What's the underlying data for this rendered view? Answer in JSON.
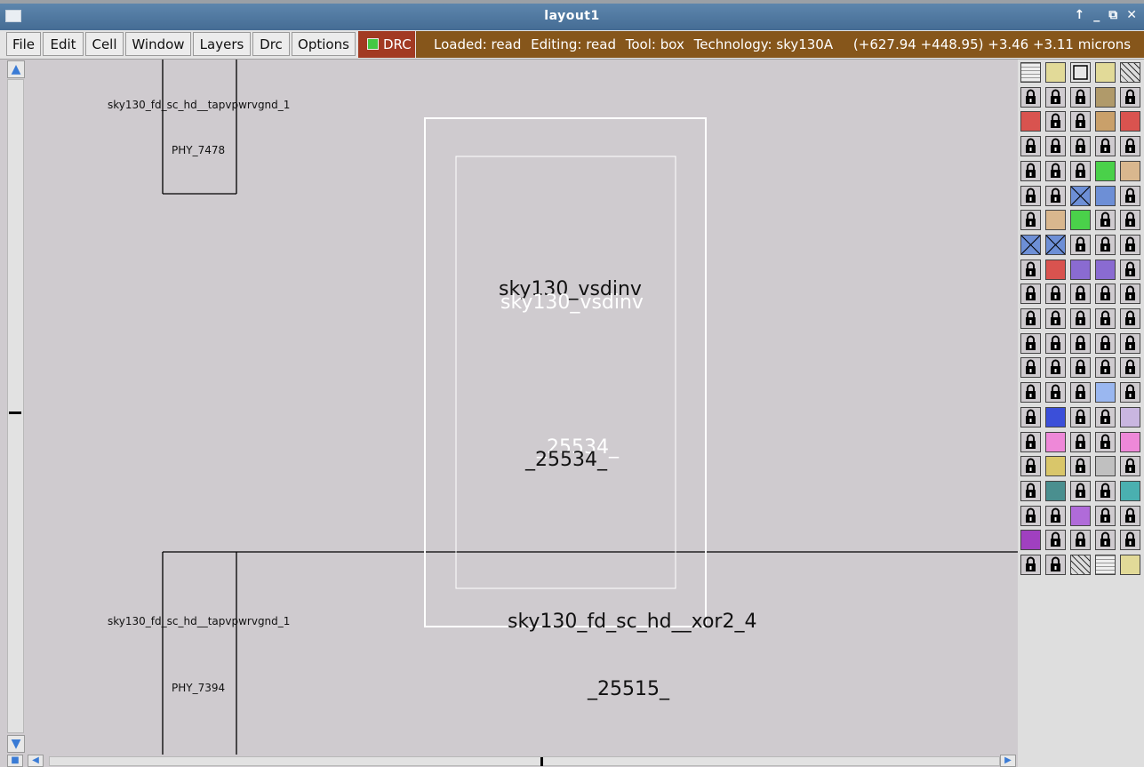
{
  "window": {
    "title": "layout1",
    "controls": [
      "↑",
      "_",
      "⧉",
      "✕"
    ]
  },
  "menubar": {
    "items": [
      "File",
      "Edit",
      "Cell",
      "Window",
      "Layers",
      "Drc",
      "Options"
    ],
    "drc_toggle": "DRC"
  },
  "status": {
    "loaded": "Loaded: read",
    "editing": "Editing: read",
    "tool": "Tool: box",
    "technology": "Technology: sky130A",
    "coords": "(+627.94 +448.95) +3.46 +3.11 microns"
  },
  "layout": {
    "cells": [
      {
        "name": "sky130_fd_sc_hd__tapvpwrvgnd_1",
        "instance": "PHY_7478"
      },
      {
        "name": "sky130_vsdinv",
        "instance": "_25534_"
      },
      {
        "name": "sky130_fd_sc_hd__tapvpwrvgnd_1",
        "instance": "PHY_7394"
      },
      {
        "name": "sky130_fd_sc_hd__xor2_4",
        "instance": "_25515_"
      }
    ]
  },
  "palette": {
    "colors": {
      "lock_bg": "#cfcbcf",
      "tan": "#d9b78e",
      "green": "#4ad14a",
      "red": "#d9534f",
      "blue": "#6d8fd6",
      "purple": "#8a6bd1",
      "pink": "#ee88d8",
      "lavender": "#c9b6e0",
      "yellow": "#e2da98"
    }
  },
  "icons": {
    "scroll_up": "arrow-up-icon",
    "scroll_down": "arrow-down-icon",
    "scroll_left": "arrow-left-icon",
    "scroll_right": "arrow-right-icon",
    "layer_lock": "lock-icon"
  }
}
